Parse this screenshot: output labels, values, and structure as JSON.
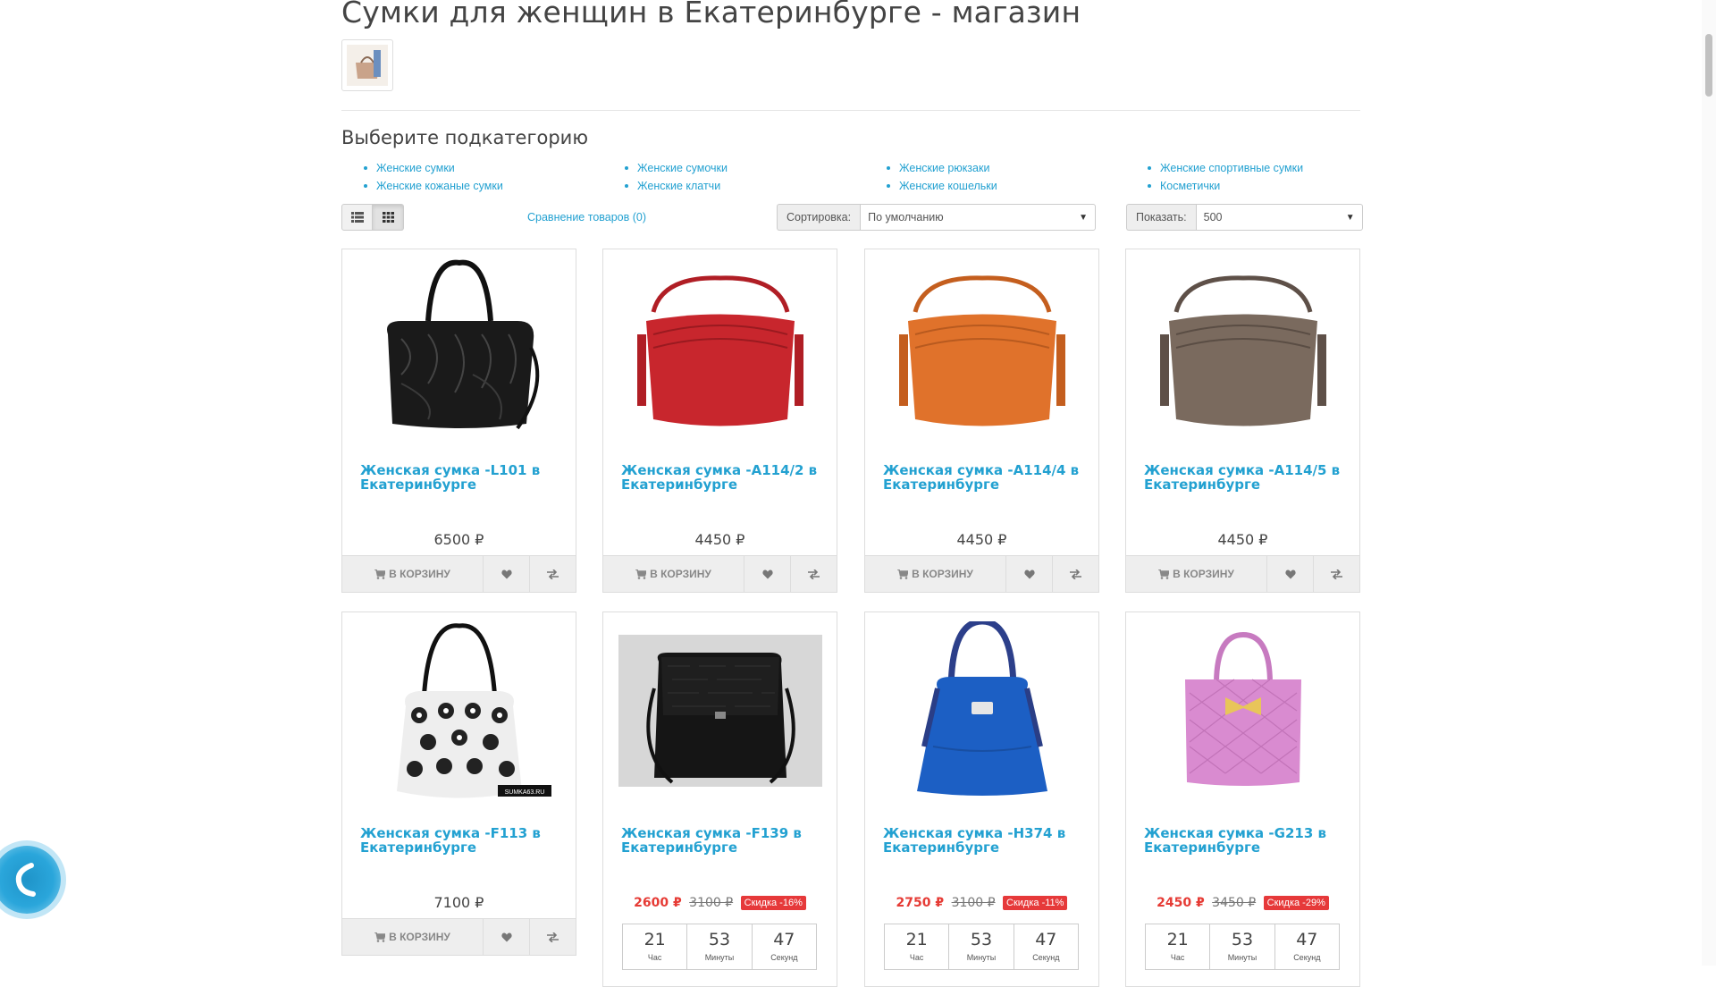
{
  "page": {
    "title": "Сумки для женщин в Екатеринбурге - магазин",
    "subcategory_heading": "Выберите подкатегорию"
  },
  "subcategories": [
    [
      "Женские сумки",
      "Женские кожаные сумки"
    ],
    [
      "Женские сумочки",
      "Женские клатчи"
    ],
    [
      "Женские рюкзаки",
      "Женские кошельки"
    ],
    [
      "Женские спортивные сумки",
      "Косметички"
    ]
  ],
  "toolbar": {
    "compare_link": "Сравнение товаров (0)",
    "sort_label": "Сортировка:",
    "sort_value": "По умолчанию",
    "limit_label": "Показать:",
    "limit_value": "500"
  },
  "products": [
    {
      "name": "Женская сумка -L101 в Екатеринбурге",
      "price": "6500 ₽",
      "image": "black-quilted-bag",
      "color": "#1a1a1a"
    },
    {
      "name": "Женская сумка -A114/2 в Екатеринбурге",
      "price": "4450 ₽",
      "image": "red-crossbody-bag",
      "color": "#c8262d"
    },
    {
      "name": "Женская сумка -A114/4 в Екатеринбурге",
      "price": "4450 ₽",
      "image": "orange-crossbody-bag",
      "color": "#e0722b"
    },
    {
      "name": "Женская сумка -A114/5 в Екатеринбурге",
      "price": "4450 ₽",
      "image": "taupe-crossbody-bag",
      "color": "#7a6a5e"
    },
    {
      "name": "Женская сумка -F113 в Екатеринбурге",
      "price": "7100 ₽",
      "image": "floral-hobo-bag",
      "color": "#222222"
    },
    {
      "name": "Женская сумка -F139 в Екатеринбурге",
      "price_new": "2600 ₽",
      "price_old": "3100 ₽",
      "discount": "Скидка -16%",
      "image": "black-croc-bag",
      "color": "#111111"
    },
    {
      "name": "Женская сумка -H374 в Екатеринбурге",
      "price_new": "2750 ₽",
      "price_old": "3100 ₽",
      "discount": "Скидка -11%",
      "image": "blue-tote-bag",
      "color": "#1c5fc4"
    },
    {
      "name": "Женская сумка -G213 в Екатеринбурге",
      "price_new": "2450 ₽",
      "price_old": "3450 ₽",
      "discount": "Скидка -29%",
      "image": "pink-quilted-bag",
      "color": "#d98bd0"
    }
  ],
  "buttons": {
    "cart_label": "В КОРЗИНУ",
    "cart_icon": "shopping-cart-icon",
    "wishlist_icon": "heart-icon",
    "compare_icon": "exchange-icon"
  },
  "timer": {
    "hours": "21",
    "minutes": "53",
    "seconds": "47",
    "hours_label": "Час",
    "minutes_label": "Минуты",
    "seconds_label": "Секунд"
  },
  "watermark": "SUMKA63.RU"
}
